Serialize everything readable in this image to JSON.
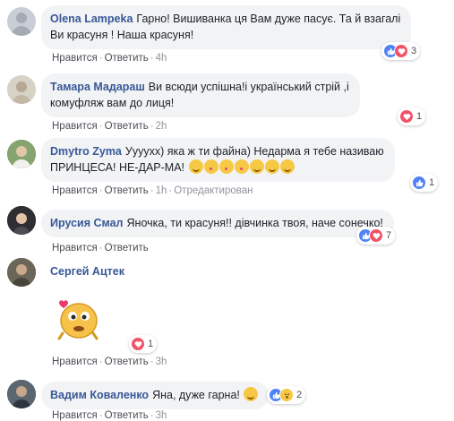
{
  "actions": {
    "like": "Нравится",
    "reply": "Ответить",
    "edited": "Отредактирован"
  },
  "comments": [
    {
      "author": "Olena Lampeka",
      "line1": "Гарно! Вишиванка ця Вам дуже пасує. Та й взагалі",
      "line2": "Ви красуня ! Наша красуня!",
      "time": "4h",
      "reaction_count": "3"
    },
    {
      "author": "Тамара Мадараш",
      "line1": "Ви всюди успішна!і український стрій ,і",
      "line2": "комуфляж вам до лиця!",
      "time": "2h",
      "reaction_count": "1"
    },
    {
      "author": "Dmytro Zyma",
      "line1": "Уууухх) яка ж ти файна) Недарма я тебе називаю",
      "line2": "ПРИНЦЕСА! НЕ-ДАР-МА!",
      "time": "1h",
      "reaction_count": "1"
    },
    {
      "author": "Ирусия Смал",
      "line1": "Яночка, ти красуня!! дівчинка твоя, наче сонечко!",
      "time": "",
      "reaction_count": "7"
    },
    {
      "author": "Сергей Ацтек",
      "time": "3h",
      "reaction_count": "1"
    },
    {
      "author": "Вадим Коваленко",
      "line1": "Яна, дуже гарна!",
      "time": "3h",
      "reaction_count": "2"
    }
  ],
  "icons": [
    "like-icon",
    "love-icon",
    "wow-icon",
    "smile-emoji-icon",
    "kiss-emoji-icon",
    "heart-eyes-emoji-icon",
    "love-sticker-icon"
  ],
  "colors": {
    "link": "#385898",
    "bubble": "#f2f3f5",
    "like": "#4f83f5",
    "love": "#f25268",
    "meta": "#90949c"
  }
}
